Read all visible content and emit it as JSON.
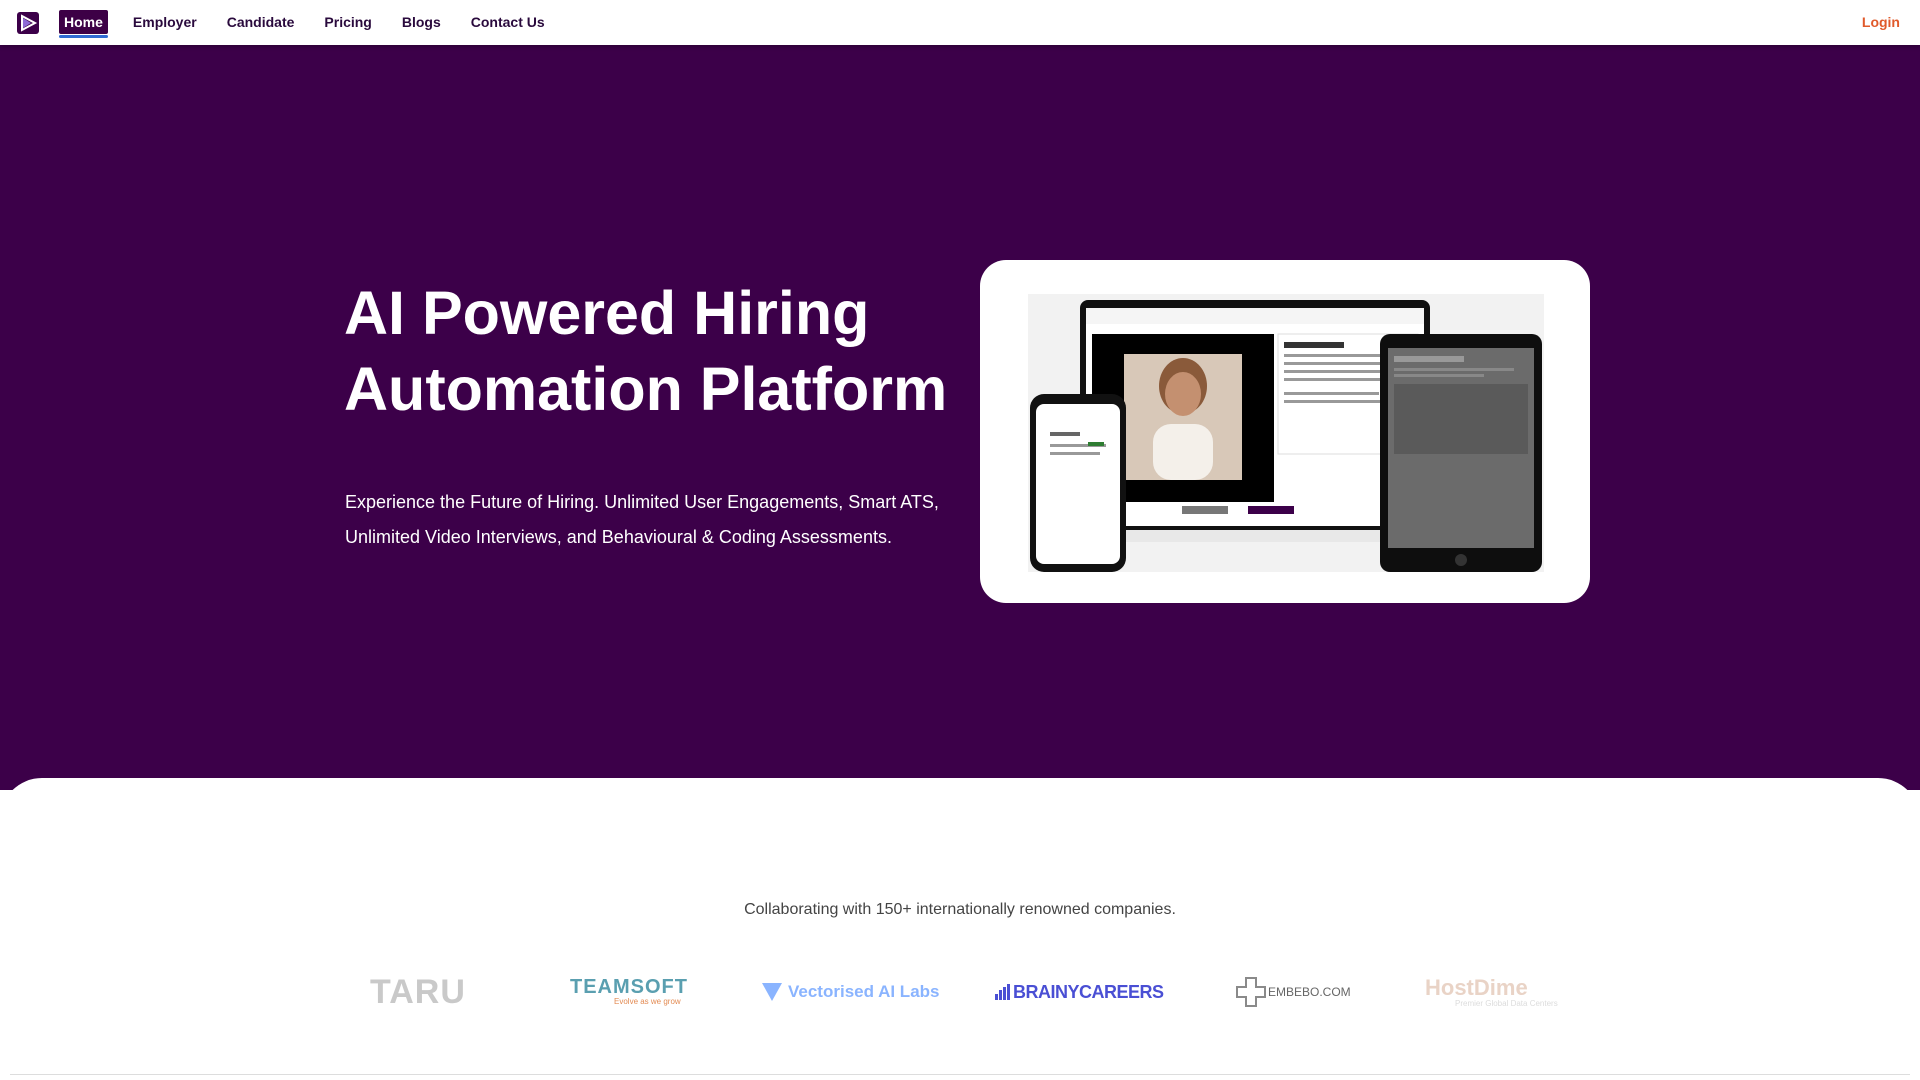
{
  "nav": {
    "items": [
      {
        "label": "Home",
        "active": true
      },
      {
        "label": "Employer"
      },
      {
        "label": "Candidate"
      },
      {
        "label": "Pricing"
      },
      {
        "label": "Blogs"
      },
      {
        "label": "Contact Us"
      }
    ],
    "login": "Login"
  },
  "hero": {
    "title_line1": "AI Powered Hiring",
    "title_line2": "Automation Platform",
    "subtitle": "Experience the Future of Hiring. Unlimited User Engagements, Smart ATS, Unlimited Video Interviews, and Behavioural & Coding Assessments."
  },
  "partners": {
    "heading": "Collaborating with 150+ internationally renowned companies.",
    "logos": [
      {
        "name": "TARU"
      },
      {
        "name": "TEAMSOFT",
        "tagline": "Evolve as we grow"
      },
      {
        "name": "Vectorised AI Labs"
      },
      {
        "name": "BRAINYCAREERS"
      },
      {
        "name": "EMBEBO.COM"
      },
      {
        "name": "HostDime",
        "tagline": "Premier Global Data Centers"
      }
    ]
  },
  "colors": {
    "brand_purple": "#3c0049",
    "login_orange": "#e05a2b",
    "active_underline": "#2f6bd3"
  }
}
